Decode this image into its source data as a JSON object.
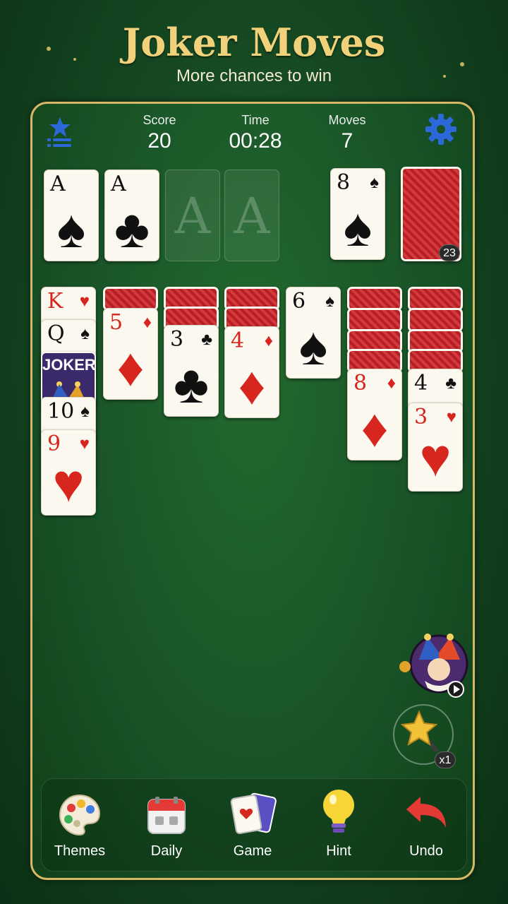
{
  "header": {
    "title": "Joker Moves",
    "subtitle": "More chances to win"
  },
  "stats": {
    "score_label": "Score",
    "score": "20",
    "time_label": "Time",
    "time": "00:28",
    "moves_label": "Moves",
    "moves": "7"
  },
  "foundations": [
    {
      "rank": "A",
      "suit": "♠",
      "color": "black"
    },
    {
      "rank": "A",
      "suit": "♣",
      "color": "black"
    },
    {
      "placeholder": "A"
    },
    {
      "placeholder": "A"
    }
  ],
  "waste": {
    "rank": "8",
    "suit": "♠"
  },
  "stock": {
    "count": "23"
  },
  "tableau": {
    "col1": [
      {
        "rank": "K",
        "suit": "♥"
      },
      {
        "rank": "Q",
        "suit": "♠"
      },
      {
        "joker": "JOKER"
      },
      {
        "rank": "10",
        "suit": "♠"
      },
      {
        "rank": "9",
        "suit": "♥"
      }
    ],
    "col2": {
      "rank": "5",
      "suit": "♦"
    },
    "col3": {
      "rank": "3",
      "suit": "♣"
    },
    "col4": {
      "rank": "4",
      "suit": "♦"
    },
    "col5": {
      "rank": "6",
      "suit": "♠"
    },
    "col6": {
      "rank": "8",
      "suit": "♦"
    },
    "col7": [
      {
        "rank": "4",
        "suit": "♣"
      },
      {
        "rank": "3",
        "suit": "♥"
      }
    ]
  },
  "powerups": {
    "wand_count": "x1"
  },
  "toolbar": {
    "themes": "Themes",
    "daily": "Daily",
    "game": "Game",
    "hint": "Hint",
    "undo": "Undo"
  },
  "colors": {
    "felt": "#185227",
    "gold": "#d6b765",
    "red": "#d7261e"
  }
}
